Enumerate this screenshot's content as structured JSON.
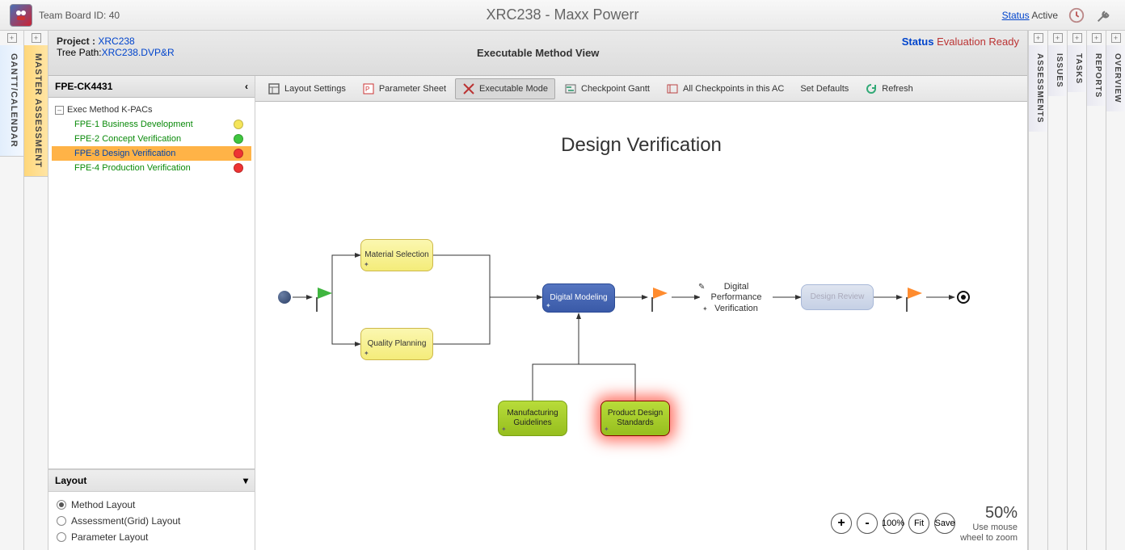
{
  "header": {
    "team_board_label": "Team Board ID: 40",
    "title": "XRC238 - Maxx Powerr",
    "status_label": "Status",
    "status_value": "Active"
  },
  "left_tabs": {
    "gantt": "GANTT/CALENDAR",
    "master": "MASTER ASSESSMENT"
  },
  "project": {
    "label": "Project  :",
    "code": "XRC238",
    "tree_path_label": "Tree Path:",
    "tree_path": "XRC238.DVP&R",
    "view_title": "Executable Method View",
    "status_label": "Status",
    "status_value": "Evaluation Ready"
  },
  "tree": {
    "header": "FPE-CK4431",
    "root": "Exec Method K-PACs",
    "items": [
      {
        "label": "FPE-1 Business Development",
        "status": "yellow",
        "selected": false
      },
      {
        "label": "FPE-2 Concept Verification",
        "status": "green",
        "selected": false
      },
      {
        "label": "FPE-8 Design Verification",
        "status": "red",
        "selected": true
      },
      {
        "label": "FPE-4 Production Verification",
        "status": "red",
        "selected": false
      }
    ]
  },
  "layout": {
    "header": "Layout",
    "options": [
      {
        "label": "Method Layout",
        "checked": true
      },
      {
        "label": "Assessment(Grid) Layout",
        "checked": false
      },
      {
        "label": "Parameter Layout",
        "checked": false
      }
    ]
  },
  "toolbar": [
    {
      "label": "Layout Settings",
      "icon": "layout",
      "active": false
    },
    {
      "label": "Parameter Sheet",
      "icon": "param",
      "active": false
    },
    {
      "label": "Executable Mode",
      "icon": "exec",
      "active": true
    },
    {
      "label": "Checkpoint Gantt",
      "icon": "gantt",
      "active": false
    },
    {
      "label": "All Checkpoints in this AC",
      "icon": "check",
      "active": false
    },
    {
      "label": "Set Defaults",
      "icon": "",
      "active": false
    },
    {
      "label": "Refresh",
      "icon": "refresh",
      "active": false
    }
  ],
  "diagram": {
    "title": "Design Verification",
    "nodes": {
      "material": "Material Selection",
      "quality": "Quality Planning",
      "digital": "Digital Modeling",
      "perf": "Digital Performance Verification",
      "review": "Design Review",
      "mfg": "Manufacturing Guidelines",
      "pds": "Product Design Standards"
    }
  },
  "zoom": {
    "plus": "+",
    "minus": "-",
    "hundred": "100%",
    "fit": "Fit",
    "save": "Save",
    "pct": "50%",
    "hint1": "Use mouse",
    "hint2": "wheel to zoom"
  },
  "right_tabs": [
    "ASSESSMENTS",
    "ISSUES",
    "TASKS",
    "REPORTS",
    "OVERVIEW"
  ]
}
